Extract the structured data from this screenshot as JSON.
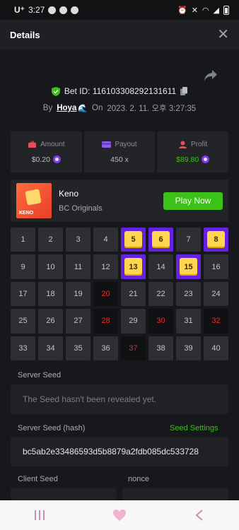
{
  "status": {
    "carrier": "U⁺",
    "time": "3:27"
  },
  "header": {
    "title": "Details",
    "close_glyph": "✕"
  },
  "bet": {
    "id_label": "Bet ID: 116103308292131611",
    "by_label": "By",
    "user": "Hoya",
    "user_emoji": "🌊",
    "on_label": "On",
    "date": "2023. 2. 11. 오후 3:27:35"
  },
  "stats": {
    "amount_label": "Amount",
    "amount_value": "$0.20",
    "payout_label": "Payout",
    "payout_value": "450 x",
    "profit_label": "Profit",
    "profit_value": "$89.80"
  },
  "game": {
    "name": "Keno",
    "provider": "BC Originals",
    "play_label": "Play Now",
    "thumb_text": "KENO"
  },
  "grid": {
    "cells": [
      {
        "n": "1",
        "s": "normal"
      },
      {
        "n": "2",
        "s": "normal"
      },
      {
        "n": "3",
        "s": "normal"
      },
      {
        "n": "4",
        "s": "normal"
      },
      {
        "n": "5",
        "s": "hit"
      },
      {
        "n": "6",
        "s": "hit"
      },
      {
        "n": "7",
        "s": "normal"
      },
      {
        "n": "8",
        "s": "hit"
      },
      {
        "n": "9",
        "s": "normal"
      },
      {
        "n": "10",
        "s": "normal"
      },
      {
        "n": "11",
        "s": "normal"
      },
      {
        "n": "12",
        "s": "normal"
      },
      {
        "n": "13",
        "s": "hit"
      },
      {
        "n": "14",
        "s": "normal"
      },
      {
        "n": "15",
        "s": "hit"
      },
      {
        "n": "16",
        "s": "normal"
      },
      {
        "n": "17",
        "s": "normal"
      },
      {
        "n": "18",
        "s": "normal"
      },
      {
        "n": "19",
        "s": "normal"
      },
      {
        "n": "20",
        "s": "miss"
      },
      {
        "n": "21",
        "s": "normal"
      },
      {
        "n": "22",
        "s": "normal"
      },
      {
        "n": "23",
        "s": "normal"
      },
      {
        "n": "24",
        "s": "normal"
      },
      {
        "n": "25",
        "s": "normal"
      },
      {
        "n": "26",
        "s": "normal"
      },
      {
        "n": "27",
        "s": "normal"
      },
      {
        "n": "28",
        "s": "miss"
      },
      {
        "n": "29",
        "s": "normal"
      },
      {
        "n": "30",
        "s": "miss"
      },
      {
        "n": "31",
        "s": "normal"
      },
      {
        "n": "32",
        "s": "miss"
      },
      {
        "n": "33",
        "s": "normal"
      },
      {
        "n": "34",
        "s": "normal"
      },
      {
        "n": "35",
        "s": "normal"
      },
      {
        "n": "36",
        "s": "normal"
      },
      {
        "n": "37",
        "s": "miss"
      },
      {
        "n": "38",
        "s": "normal"
      },
      {
        "n": "39",
        "s": "normal"
      },
      {
        "n": "40",
        "s": "normal"
      }
    ]
  },
  "server_seed": {
    "label": "Server Seed",
    "value": "The Seed hasn't been revealed yet."
  },
  "server_hash": {
    "label": "Server Seed (hash)",
    "settings_link": "Seed Settings",
    "value": "bc5ab2e33486593d5b8879a2fdb085dc533728"
  },
  "client_seed": {
    "label": "Client Seed"
  },
  "nonce": {
    "label": "nonce"
  },
  "colors": {
    "accent_green": "#3bc117",
    "hit_purple": "#6522e0",
    "miss_red": "#e02e2e",
    "tile_yellow": "#ffd64d"
  }
}
